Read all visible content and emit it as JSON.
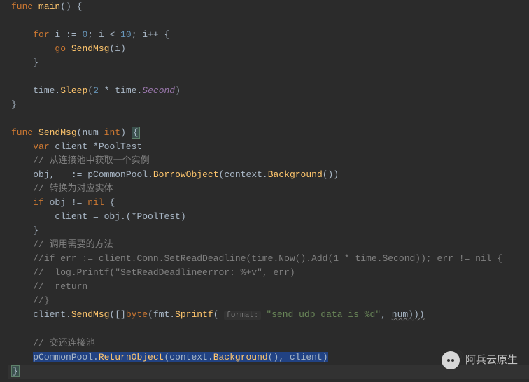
{
  "code": {
    "l1": {
      "kw_func": "func",
      "fn": "main",
      "rest": "() {"
    },
    "l3": {
      "kw_for": "for",
      "txt1": " i ",
      "op1": ":=",
      "sp1": " ",
      "n0": "0",
      "txt2": "; i < ",
      "n10": "10",
      "txt3": "; i++ {"
    },
    "l4": {
      "kw_go": "go",
      "sp": " ",
      "fn": "SendMsg",
      "rest": "(i)"
    },
    "l5": {
      "brace": "}"
    },
    "l7": {
      "txt1": "time.",
      "fn": "Sleep",
      "lp": "(",
      "n2": "2",
      "txt2": " * time.",
      "const": "Second",
      "rp": ")"
    },
    "l8": {
      "brace": "}"
    },
    "l10": {
      "kw_func": "func",
      "sp": " ",
      "fn": "SendMsg",
      "lp": "(",
      "p": "num ",
      "kw_int": "int",
      "rp": ") ",
      "brace": "{"
    },
    "l11": {
      "kw_var": "var",
      "txt": " client *PoolTest"
    },
    "l12": {
      "cmt": "// 从连接池中获取一个实例"
    },
    "l13": {
      "txt1": "obj",
      "comma": ",",
      "blank": " _ ",
      "op": ":=",
      "txt2": " pCommonPool.",
      "fn1": "BorrowObject",
      "lp": "(",
      "txt3": "context.",
      "fn2": "Background",
      "rp": "())"
    },
    "l14": {
      "cmt": "// 转换为对应实体"
    },
    "l15": {
      "kw_if": "if",
      "txt1": " obj != ",
      "kw_nil": "nil",
      "txt2": " {"
    },
    "l16": {
      "txt1": "client = obj.(*PoolTest)"
    },
    "l17": {
      "brace": "}"
    },
    "l18": {
      "cmt": "// 调用需要的方法"
    },
    "l19": {
      "cmt": "//if err := client.Conn.SetReadDeadline(time.Now().Add(1 * time.Second)); err != nil {"
    },
    "l20": {
      "cmt": "//  log.Printf(\"SetReadDeadlineerror: %+v\", err)"
    },
    "l21": {
      "cmt": "//  return"
    },
    "l22": {
      "cmt": "//}"
    },
    "l23": {
      "txt1": "client.",
      "fn1": "SendMsg",
      "lp1": "([]",
      "kw_byte": "byte",
      "lp2": "(fmt.",
      "fn2": "Sprintf",
      "lp3": "( ",
      "hint": "format:",
      "sp": " ",
      "str": "\"send_udp_data_is_%d\"",
      "txt2": ", ",
      "wavy": "num)))"
    },
    "l25": {
      "cmt": "// 交还连接池"
    },
    "l26": {
      "txt1": "pCommonPool.",
      "fn1": "ReturnObject",
      "lp": "(",
      "txt2": "context.",
      "fn2": "Background",
      "mid": "(), client)"
    },
    "l27": {
      "brace": "}"
    }
  },
  "watermark": {
    "text": "阿兵云原生"
  }
}
